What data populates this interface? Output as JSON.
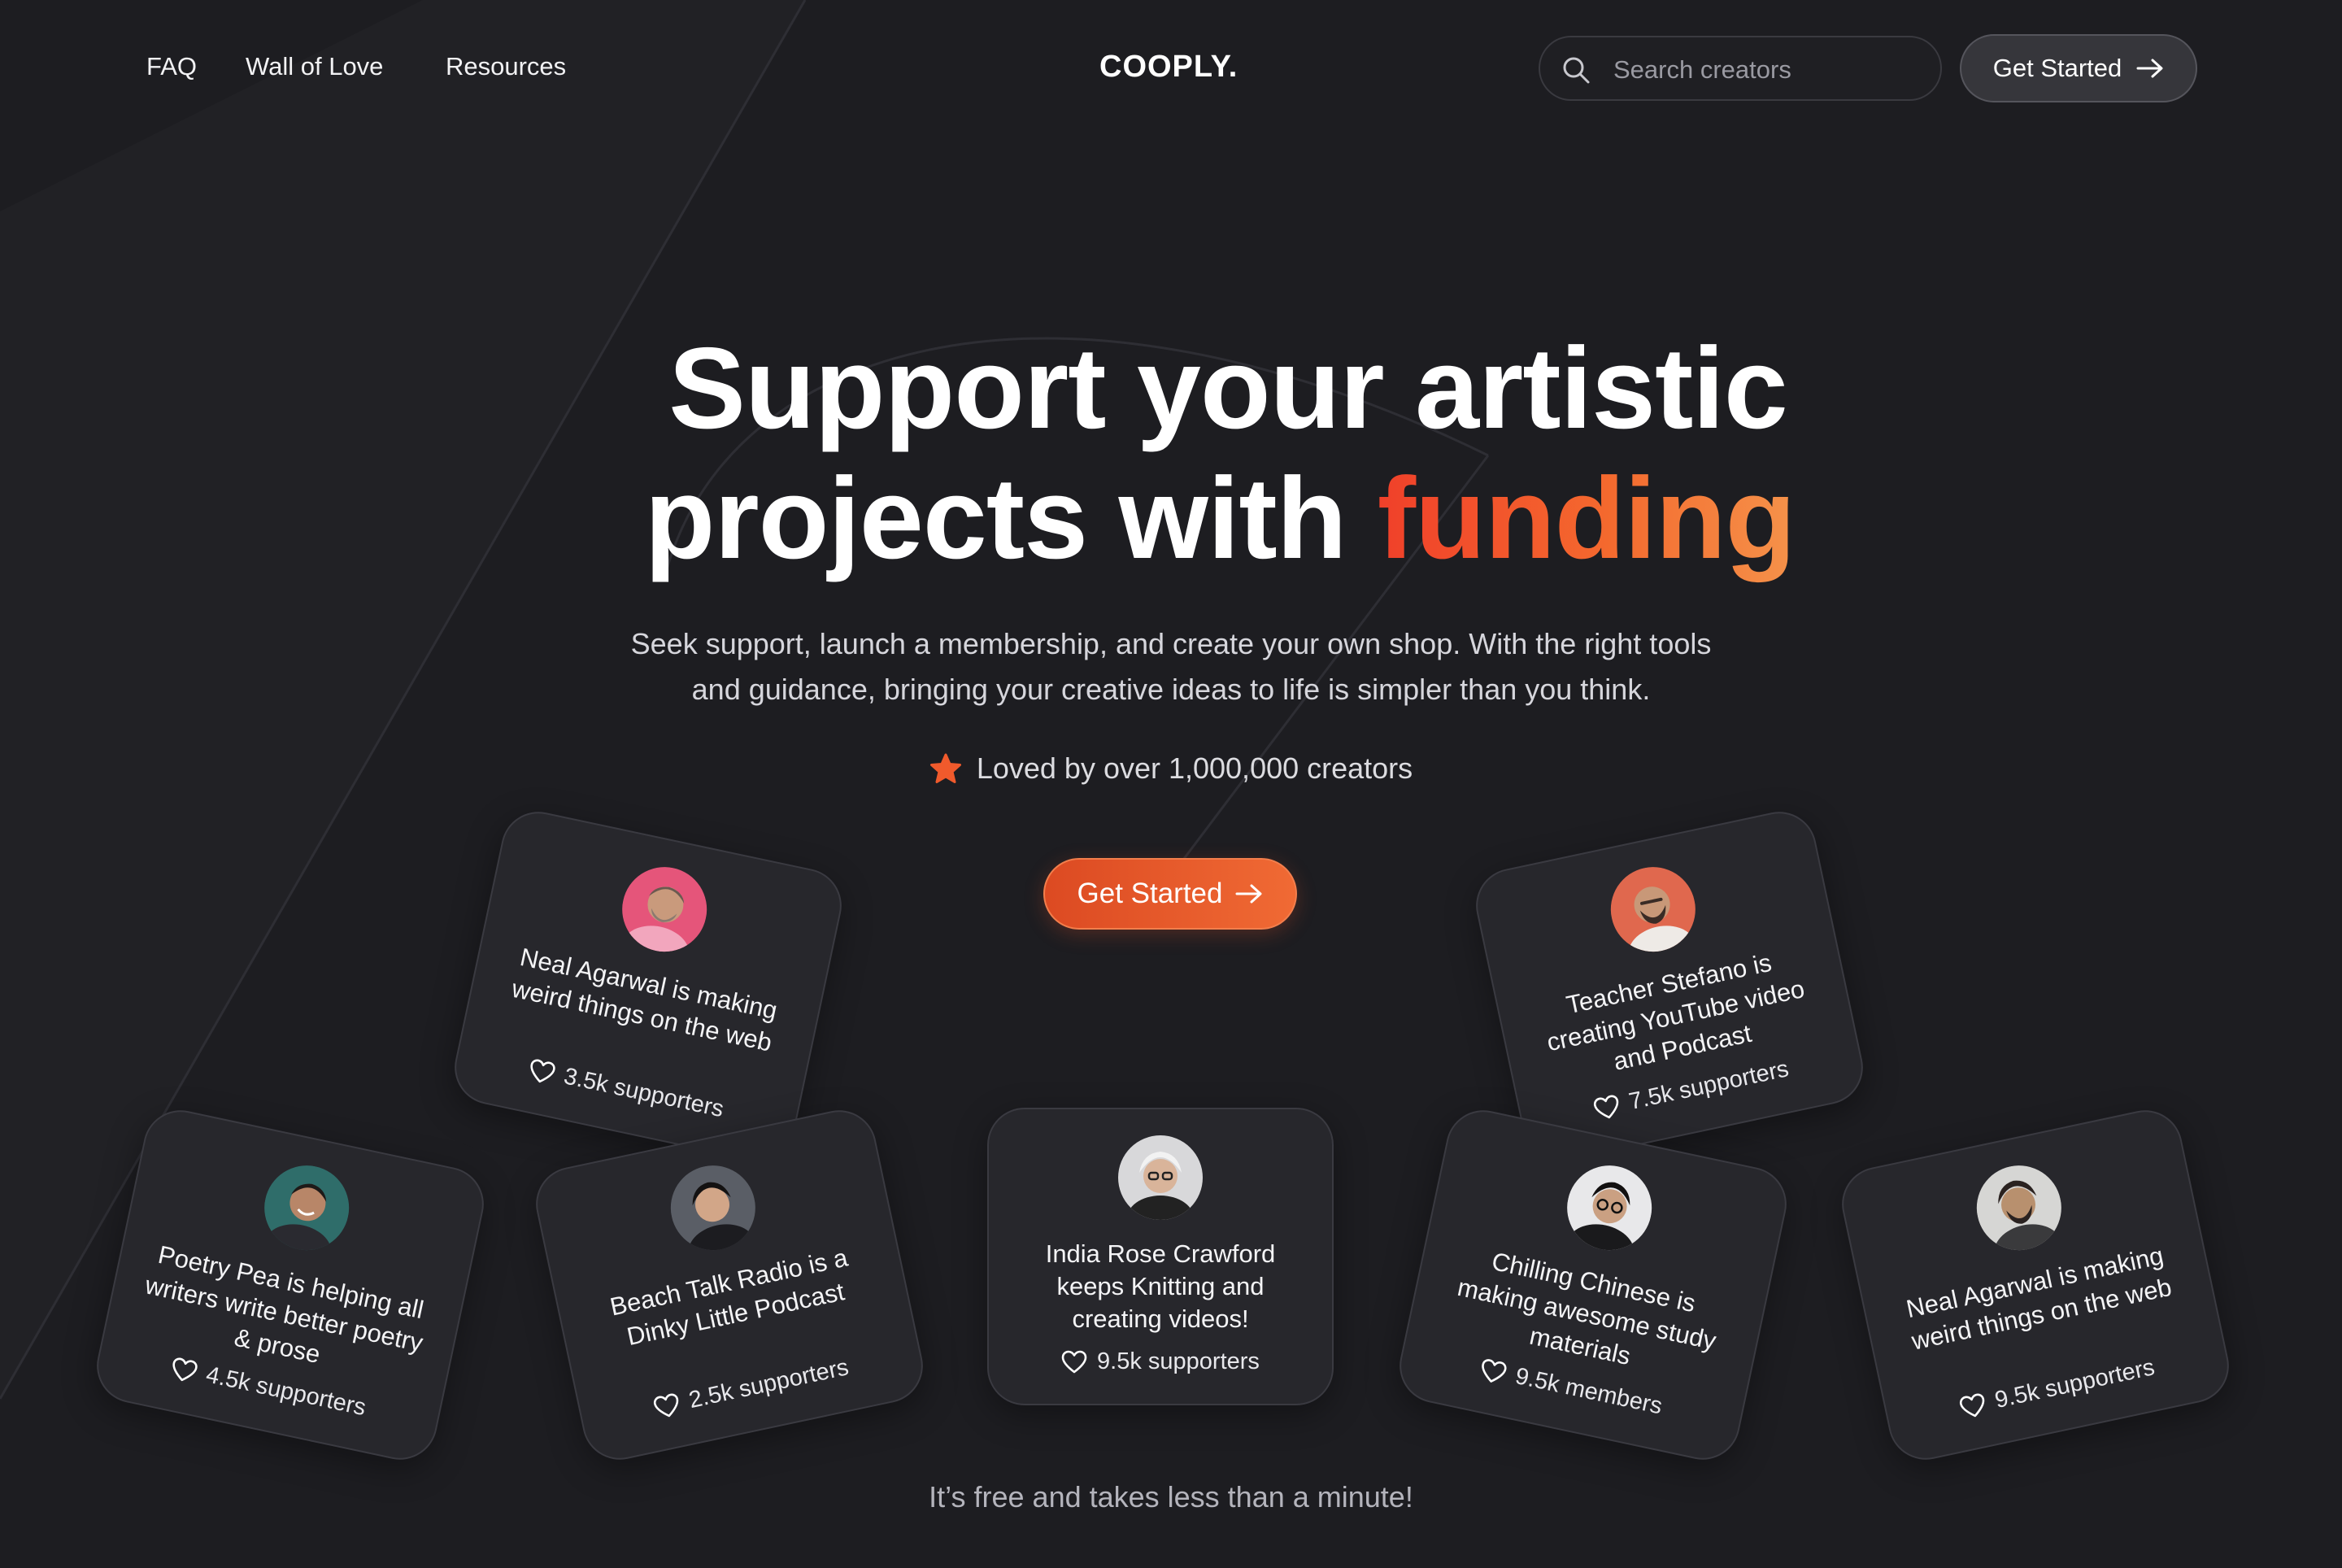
{
  "nav": {
    "links": [
      "FAQ",
      "Wall of Love",
      "Resources"
    ],
    "logo": "COOPLY.",
    "search_placeholder": "Search creators",
    "cta_label": "Get Started"
  },
  "hero": {
    "headline_line1": "Support your artistic",
    "headline_line2_plain": "projects with ",
    "headline_accent": "funding",
    "subtitle_line1": "Seek support, launch a membership, and create your own shop. With the right tools",
    "subtitle_line2": "and guidance, bringing your creative ideas to life is simpler than you think.",
    "loved_text": "Loved by over 1,000,000 creators",
    "cta_label": "Get Started",
    "footnote": "It’s free and takes less than a minute!"
  },
  "cards": [
    {
      "title": "Neal Agarwal is making weird things on the web",
      "supporters": "3.5k supporters",
      "avatar_icon": "avatar-pink-shirt-icon"
    },
    {
      "title": "Teacher Stefano is creating YouTube video and Podcast",
      "supporters": "7.5k supporters",
      "avatar_icon": "avatar-bald-man-icon"
    },
    {
      "title": "Poetry Pea is helping all writers write better poetry & prose",
      "supporters": "4.5k supporters",
      "avatar_icon": "avatar-smiling-man-icon"
    },
    {
      "title": "Beach Talk Radio is a Dinky Little Podcast",
      "supporters": "2.5k supporters",
      "avatar_icon": "avatar-young-man-icon"
    },
    {
      "title": "India Rose Crawford keeps Knitting and creating videos!",
      "supporters": "9.5k supporters",
      "avatar_icon": "avatar-white-hair-icon"
    },
    {
      "title": "Chilling Chinese is making awesome study materials",
      "supporters": "9.5k members",
      "avatar_icon": "avatar-glasses-icon"
    },
    {
      "title": "Neal Agarwal is making weird things on the web",
      "supporters": "9.5k supporters",
      "avatar_icon": "avatar-bearded-man-icon"
    }
  ],
  "colors": {
    "background": "#1d1d21",
    "card": "#27272c",
    "accent_start": "#f0402a",
    "accent_end": "#f5924a",
    "cta": "#e85a2a"
  }
}
